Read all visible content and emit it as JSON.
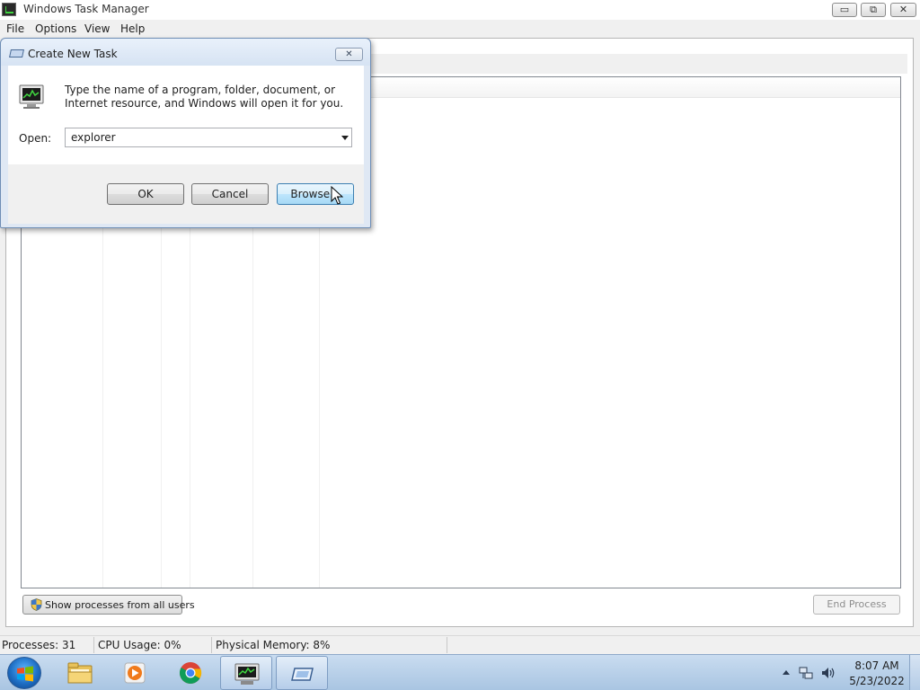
{
  "window": {
    "title": "Windows Task Manager",
    "controls": {
      "minimize": "▭",
      "maximize": "⧉",
      "close": "✕"
    }
  },
  "menu": {
    "items": [
      "File",
      "Options",
      "View",
      "Help"
    ]
  },
  "process_tab": {
    "show_all_users_label": "Show processes from all users",
    "end_process_label": "End Process"
  },
  "status_bar": {
    "processes": "Processes: 31",
    "cpu_usage": "CPU Usage: 0%",
    "physical_memory": "Physical Memory: 8%"
  },
  "dialog": {
    "title": "Create New Task",
    "close_glyph": "✕",
    "instructions": "Type the name of a program, folder, document, or Internet resource, and Windows will open it for you.",
    "open_label": "Open:",
    "open_value": "explorer",
    "buttons": {
      "ok": "OK",
      "cancel": "Cancel",
      "browse": "Browse..."
    }
  },
  "taskbar": {
    "items": [
      "windows-explorer",
      "media-player",
      "google-chrome",
      "task-manager",
      "run-dialog"
    ],
    "active_items": [
      "task-manager",
      "run-dialog"
    ],
    "clock": {
      "time": "8:07 AM",
      "date": "5/23/2022"
    }
  },
  "colors": {
    "taskbar": "#b7cfea",
    "dialog_frame": "#dfe8f4",
    "focused_button": "#bee6fd"
  }
}
